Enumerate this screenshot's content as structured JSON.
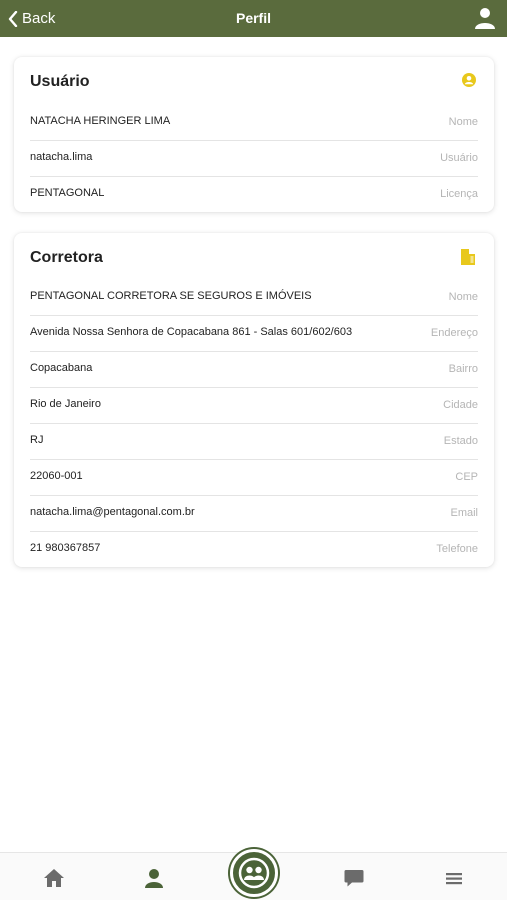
{
  "header": {
    "back_label": "Back",
    "title": "Perfil"
  },
  "colors": {
    "header_bg": "#5a6b3d",
    "accent_yellow": "#e8c81c",
    "nav_active": "#4b6338",
    "nav_inactive": "#6b6b6b"
  },
  "usuario": {
    "title": "Usuário",
    "icon": "user-circle-icon",
    "rows": [
      {
        "value": "NATACHA HERINGER LIMA",
        "label": "Nome"
      },
      {
        "value": "natacha.lima",
        "label": "Usuário"
      },
      {
        "value": "PENTAGONAL",
        "label": "Licença"
      }
    ]
  },
  "corretora": {
    "title": "Corretora",
    "icon": "building-icon",
    "rows": [
      {
        "value": "PENTAGONAL CORRETORA SE SEGUROS E IMÓVEIS",
        "label": "Nome"
      },
      {
        "value": "Avenida Nossa Senhora de Copacabana 861 - Salas 601/602/603",
        "label": "Endereço"
      },
      {
        "value": "Copacabana",
        "label": "Bairro"
      },
      {
        "value": "Rio de Janeiro",
        "label": "Cidade"
      },
      {
        "value": "RJ",
        "label": "Estado"
      },
      {
        "value": "22060-001",
        "label": "CEP"
      },
      {
        "value": "natacha.lima@pentagonal.com.br",
        "label": "Email"
      },
      {
        "value": "21 980367857",
        "label": "Telefone"
      }
    ]
  },
  "bottom_nav": [
    {
      "name": "home-icon"
    },
    {
      "name": "profile-icon"
    },
    {
      "name": "group-icon"
    },
    {
      "name": "chat-icon"
    },
    {
      "name": "menu-icon"
    }
  ]
}
